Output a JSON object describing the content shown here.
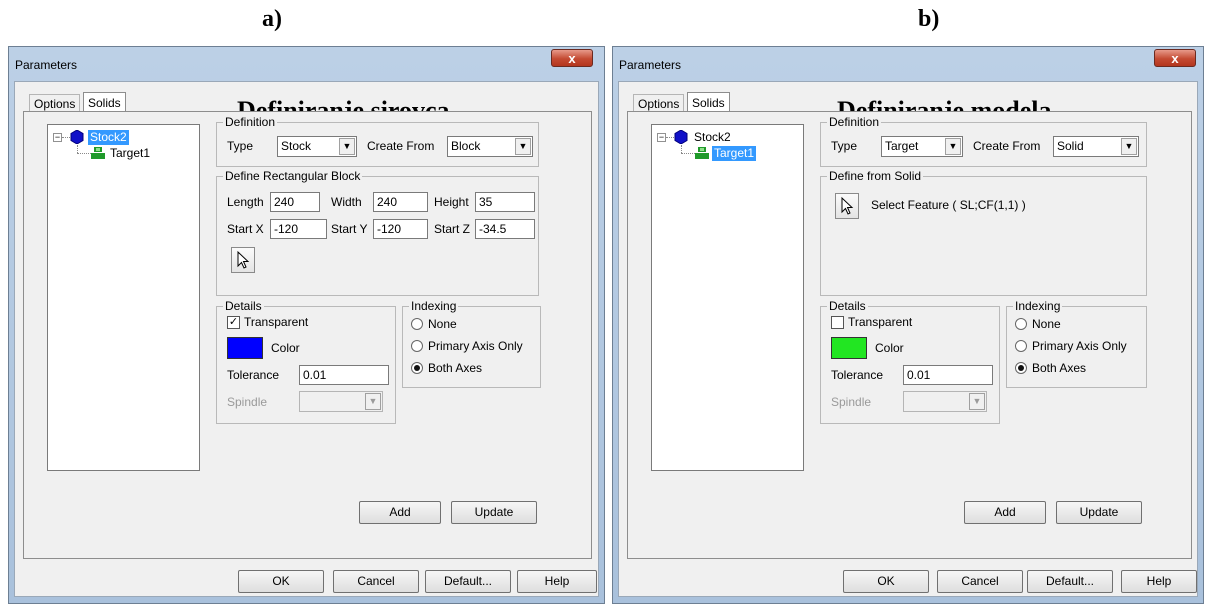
{
  "captions": {
    "a": "a)",
    "b": "b)"
  },
  "dialogs": [
    {
      "title": "Parameters",
      "close_label": "x",
      "tabs": [
        "Options",
        "Solids"
      ],
      "overlay_heading": "Definiranje sirovca",
      "tree": {
        "root": "Stock2",
        "child": "Target1",
        "selected": "Stock2"
      },
      "definition": {
        "group": "Definition",
        "type_label": "Type",
        "type_value": "Stock",
        "create_from_label": "Create From",
        "create_from_value": "Block"
      },
      "block": {
        "group": "Define Rectangular Block",
        "length_label": "Length",
        "length": "240",
        "width_label": "Width",
        "width": "240",
        "height_label": "Height",
        "height": "35",
        "startx_label": "Start X",
        "startx": "-120",
        "starty_label": "Start Y",
        "starty": "-120",
        "startz_label": "Start Z",
        "startz": "-34.5"
      },
      "details": {
        "group": "Details",
        "transparent_label": "Transparent",
        "transparent_checked": true,
        "color_label": "Color",
        "color": "#0000ff",
        "tolerance_label": "Tolerance",
        "tolerance": "0.01",
        "spindle_label": "Spindle"
      },
      "indexing": {
        "group": "Indexing",
        "options": [
          "None",
          "Primary Axis Only",
          "Both Axes"
        ],
        "selected": "Both Axes"
      },
      "buttons": {
        "add": "Add",
        "update": "Update",
        "ok": "OK",
        "cancel": "Cancel",
        "default": "Default...",
        "help": "Help"
      }
    },
    {
      "title": "Parameters",
      "close_label": "x",
      "tabs": [
        "Options",
        "Solids"
      ],
      "overlay_heading": "Definiranje modela",
      "tree": {
        "root": "Stock2",
        "child": "Target1",
        "selected": "Target1"
      },
      "definition": {
        "group": "Definition",
        "type_label": "Type",
        "type_value": "Target",
        "create_from_label": "Create From",
        "create_from_value": "Solid"
      },
      "solid": {
        "group": "Define from Solid",
        "select_label": "Select Feature ( SL;CF(1,1) )"
      },
      "details": {
        "group": "Details",
        "transparent_label": "Transparent",
        "transparent_checked": false,
        "color_label": "Color",
        "color": "#22e622",
        "tolerance_label": "Tolerance",
        "tolerance": "0.01",
        "spindle_label": "Spindle"
      },
      "indexing": {
        "group": "Indexing",
        "options": [
          "None",
          "Primary Axis Only",
          "Both Axes"
        ],
        "selected": "Both Axes"
      },
      "buttons": {
        "add": "Add",
        "update": "Update",
        "ok": "OK",
        "cancel": "Cancel",
        "default": "Default...",
        "help": "Help"
      }
    }
  ],
  "colors": {
    "window_frame": "#bcd0e6",
    "close_button": "#c44a32",
    "selection": "#3399ff",
    "stock_icon": "#1010c8",
    "target_icon": "#1f9a2a"
  }
}
